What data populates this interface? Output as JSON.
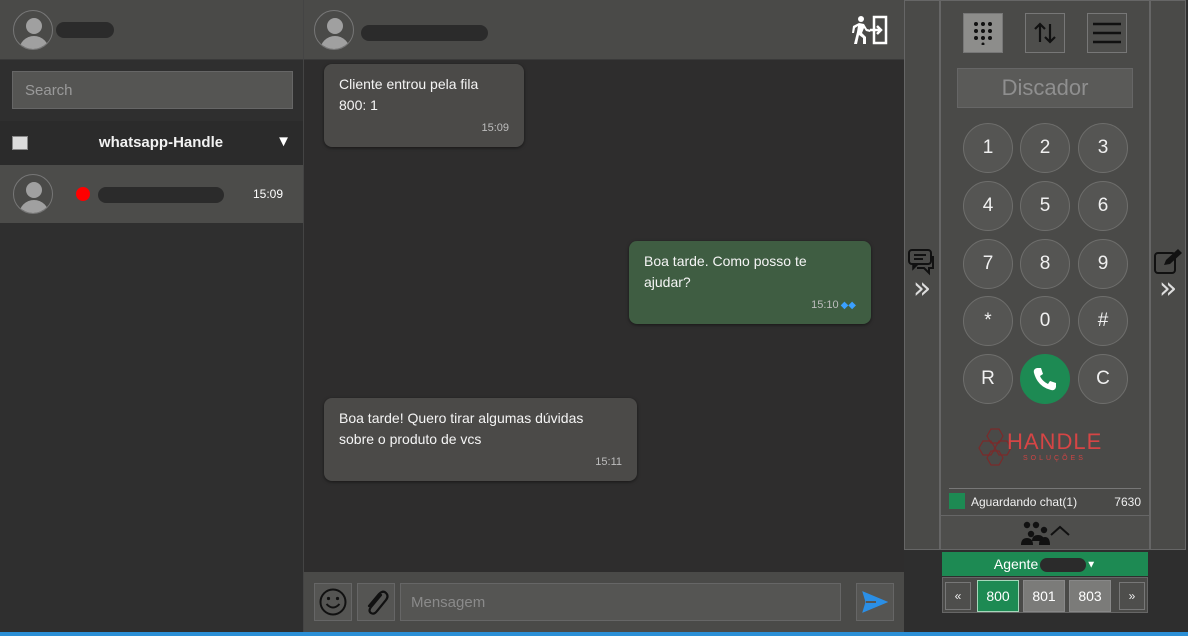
{
  "sidebar": {
    "search_placeholder": "Search",
    "group": {
      "title": "whatsapp-Handle",
      "caret": "▼"
    },
    "contacts": [
      {
        "time": "15:09"
      }
    ]
  },
  "chat": {
    "messages": [
      {
        "direction": "in",
        "text": "Cliente entrou pela fila 800: 1",
        "time": "15:09"
      },
      {
        "direction": "out",
        "text": "Boa tarde. Como posso te ajudar?",
        "time": "15:10"
      },
      {
        "direction": "in",
        "text": "Boa tarde! Quero tirar algumas dúvidas sobre o produto de vcs",
        "time": "15:11"
      }
    ],
    "composer": {
      "placeholder": "Mensagem"
    }
  },
  "dialer": {
    "display_placeholder": "Discador",
    "keys": [
      "1",
      "2",
      "3",
      "4",
      "5",
      "6",
      "7",
      "8",
      "9",
      "*",
      "0",
      "#",
      "R",
      "call",
      "C"
    ],
    "logo": {
      "brand": "HANDLE",
      "sub": "SOLUÇÕES"
    },
    "status": {
      "label": "Aguardando chat(1)",
      "number": "7630"
    },
    "agent_label": "Agente",
    "queues": [
      "800",
      "801",
      "803"
    ],
    "active_queue": "800",
    "prev": "«",
    "next": "»"
  },
  "colors": {
    "accent_green": "#1d8a53",
    "outgoing_bubble": "#3f5d42",
    "status_red": "#ff0000",
    "read_ticks": "#3aa0ff"
  }
}
